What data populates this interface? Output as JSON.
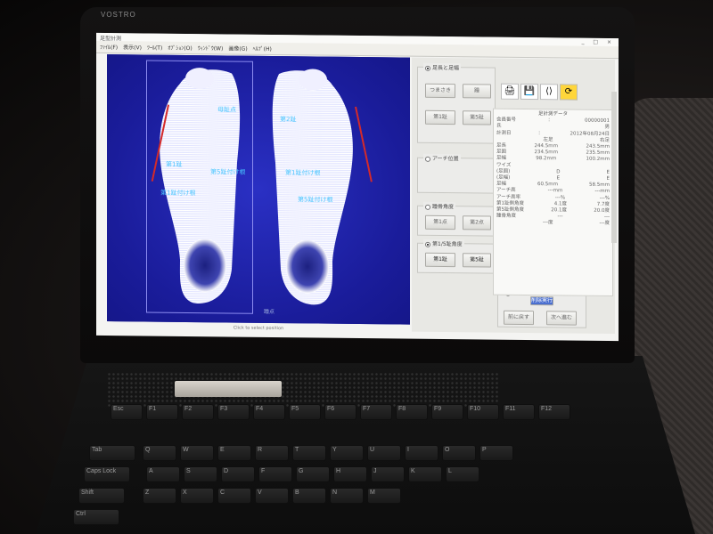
{
  "laptop": {
    "brand": "VOSTRO",
    "keys_row1": [
      "Esc",
      "F1",
      "F2",
      "F3",
      "F4",
      "F5",
      "F6",
      "F7",
      "F8",
      "F9",
      "F10",
      "F11",
      "F12"
    ],
    "keys_left": [
      "Tab",
      "Caps Lock",
      "Shift",
      "Ctrl"
    ],
    "keys_letters_row": [
      "Q",
      "W",
      "E",
      "R",
      "T",
      "Y",
      "U",
      "I",
      "O",
      "P"
    ],
    "keys_home_row": [
      "A",
      "S",
      "D",
      "F",
      "G",
      "H",
      "J",
      "K",
      "L"
    ],
    "keys_bottom_row": [
      "Z",
      "X",
      "C",
      "V",
      "B",
      "N",
      "M"
    ]
  },
  "app": {
    "title": "足型計測",
    "menu": [
      "ﾌｧｲﾙ(F)",
      "表示(V)",
      "ﾂｰﾙ(T)",
      "ｵﾌﾟｼｮﾝ(O)",
      "ｳｨﾝﾄﾞｳ(W)",
      "画像(G)",
      "ﾍﾙﾌﾟ(H)"
    ],
    "window_buttons": "_ □ ×",
    "status": "Click to select position",
    "foot_labels": {
      "left_toe": "母趾点",
      "left_mid": "第1趾",
      "left_mtp": "第5趾付け根",
      "left_arch": "第1趾付け根",
      "right_toe": "第2趾",
      "right_mid": "第1趾付け根",
      "right_arch": "第5趾付け根",
      "bottom": "踵点"
    }
  },
  "panel": {
    "group1": {
      "title": "足長と足幅",
      "btn1": "つまさき",
      "btn2": "踵",
      "btn3": "第1趾",
      "btn4": "第5趾"
    },
    "group2": {
      "title": "アーチ位置"
    },
    "group3": {
      "title": "踵骨角度",
      "btn1": "第1点",
      "btn2": "第2点"
    },
    "group4": {
      "title": "第1/5趾角度",
      "btn1": "第1趾",
      "btn2": "第5趾"
    },
    "group5": {
      "title": "計測の削除",
      "btn_main": "削除実行",
      "btn1": "前に戻す",
      "btn2": "次へ進む"
    }
  },
  "data_panel": {
    "title": "足計測データ",
    "rows": [
      {
        "label": "会員番号",
        "v1": "：",
        "v2": "00000001"
      },
      {
        "label": "氏",
        "v1": "",
        "v2": "男"
      },
      {
        "label": "計測日",
        "v1": "：",
        "v2": "2012年08月24日"
      },
      {
        "label": "",
        "v1": "左足",
        "v2": "右足"
      },
      {
        "label": "足長",
        "v1": "244.5mm",
        "v2": "243.5mm"
      },
      {
        "label": "足囲",
        "v1": "234.5mm",
        "v2": "235.5mm"
      },
      {
        "label": "足幅",
        "v1": "98.2mm",
        "v2": "100.2mm"
      },
      {
        "label": "ワイズ",
        "v1": "",
        "v2": ""
      },
      {
        "label": "(足囲)",
        "v1": "D",
        "v2": "E"
      },
      {
        "label": "(足幅)",
        "v1": "E",
        "v2": "E"
      },
      {
        "label": "足幅",
        "v1": "60.5mm",
        "v2": "58.5mm"
      },
      {
        "label": "アーチ高",
        "v1": "---mm",
        "v2": "---mm"
      },
      {
        "label": "アーチ高率",
        "v1": "---%",
        "v2": "---%"
      },
      {
        "label": "第1趾側角度",
        "v1": "4.1度",
        "v2": "7.7度"
      },
      {
        "label": "第5趾側角度",
        "v1": "20.1度",
        "v2": "20.0度"
      },
      {
        "label": "踵骨角度",
        "v1": "---",
        "v2": "---"
      },
      {
        "label": "",
        "v1": "---度",
        "v2": "---度"
      }
    ]
  },
  "colors": {
    "canvas": "#1b1fa5",
    "label": "#49c6ff",
    "guide": "#d42a2a"
  }
}
